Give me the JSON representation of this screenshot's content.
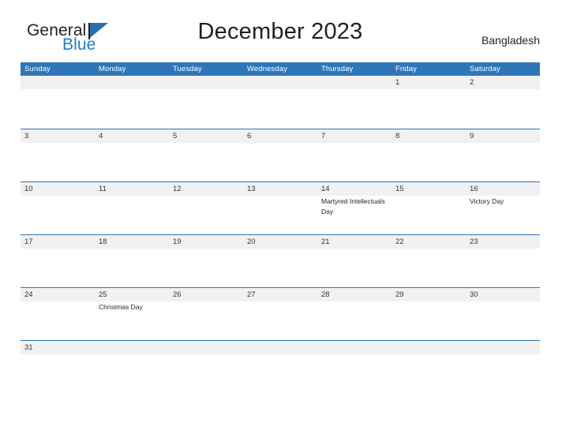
{
  "brand": {
    "name_part1": "General",
    "name_part2": "Blue",
    "flag_icon": "flag-triangle-icon",
    "color_dark": "#231f20",
    "color_blue": "#1f7fc4"
  },
  "header": {
    "title": "December 2023",
    "country": "Bangladesh"
  },
  "theme": {
    "header_blue": "#2f76b9",
    "row_line_blue": "#2f76b9",
    "day_band_gray": "#f1f1f1",
    "text_dark": "#231f20"
  },
  "calendar": {
    "month": "December",
    "year": "2023",
    "weekday_headers": [
      "Sunday",
      "Monday",
      "Tuesday",
      "Wednesday",
      "Thursday",
      "Friday",
      "Saturday"
    ],
    "weeks": [
      [
        {
          "date": "",
          "event": ""
        },
        {
          "date": "",
          "event": ""
        },
        {
          "date": "",
          "event": ""
        },
        {
          "date": "",
          "event": ""
        },
        {
          "date": "",
          "event": ""
        },
        {
          "date": "1",
          "event": ""
        },
        {
          "date": "2",
          "event": ""
        }
      ],
      [
        {
          "date": "3",
          "event": ""
        },
        {
          "date": "4",
          "event": ""
        },
        {
          "date": "5",
          "event": ""
        },
        {
          "date": "6",
          "event": ""
        },
        {
          "date": "7",
          "event": ""
        },
        {
          "date": "8",
          "event": ""
        },
        {
          "date": "9",
          "event": ""
        }
      ],
      [
        {
          "date": "10",
          "event": ""
        },
        {
          "date": "11",
          "event": ""
        },
        {
          "date": "12",
          "event": ""
        },
        {
          "date": "13",
          "event": ""
        },
        {
          "date": "14",
          "event": "Martyred Intellectuals Day"
        },
        {
          "date": "15",
          "event": ""
        },
        {
          "date": "16",
          "event": "Victory Day"
        }
      ],
      [
        {
          "date": "17",
          "event": ""
        },
        {
          "date": "18",
          "event": ""
        },
        {
          "date": "19",
          "event": ""
        },
        {
          "date": "20",
          "event": ""
        },
        {
          "date": "21",
          "event": ""
        },
        {
          "date": "22",
          "event": ""
        },
        {
          "date": "23",
          "event": ""
        }
      ],
      [
        {
          "date": "24",
          "event": ""
        },
        {
          "date": "25",
          "event": "Christmas Day"
        },
        {
          "date": "26",
          "event": ""
        },
        {
          "date": "27",
          "event": ""
        },
        {
          "date": "28",
          "event": ""
        },
        {
          "date": "29",
          "event": ""
        },
        {
          "date": "30",
          "event": ""
        }
      ],
      [
        {
          "date": "31",
          "event": ""
        },
        {
          "date": "",
          "event": ""
        },
        {
          "date": "",
          "event": ""
        },
        {
          "date": "",
          "event": ""
        },
        {
          "date": "",
          "event": ""
        },
        {
          "date": "",
          "event": ""
        },
        {
          "date": "",
          "event": ""
        }
      ]
    ]
  }
}
